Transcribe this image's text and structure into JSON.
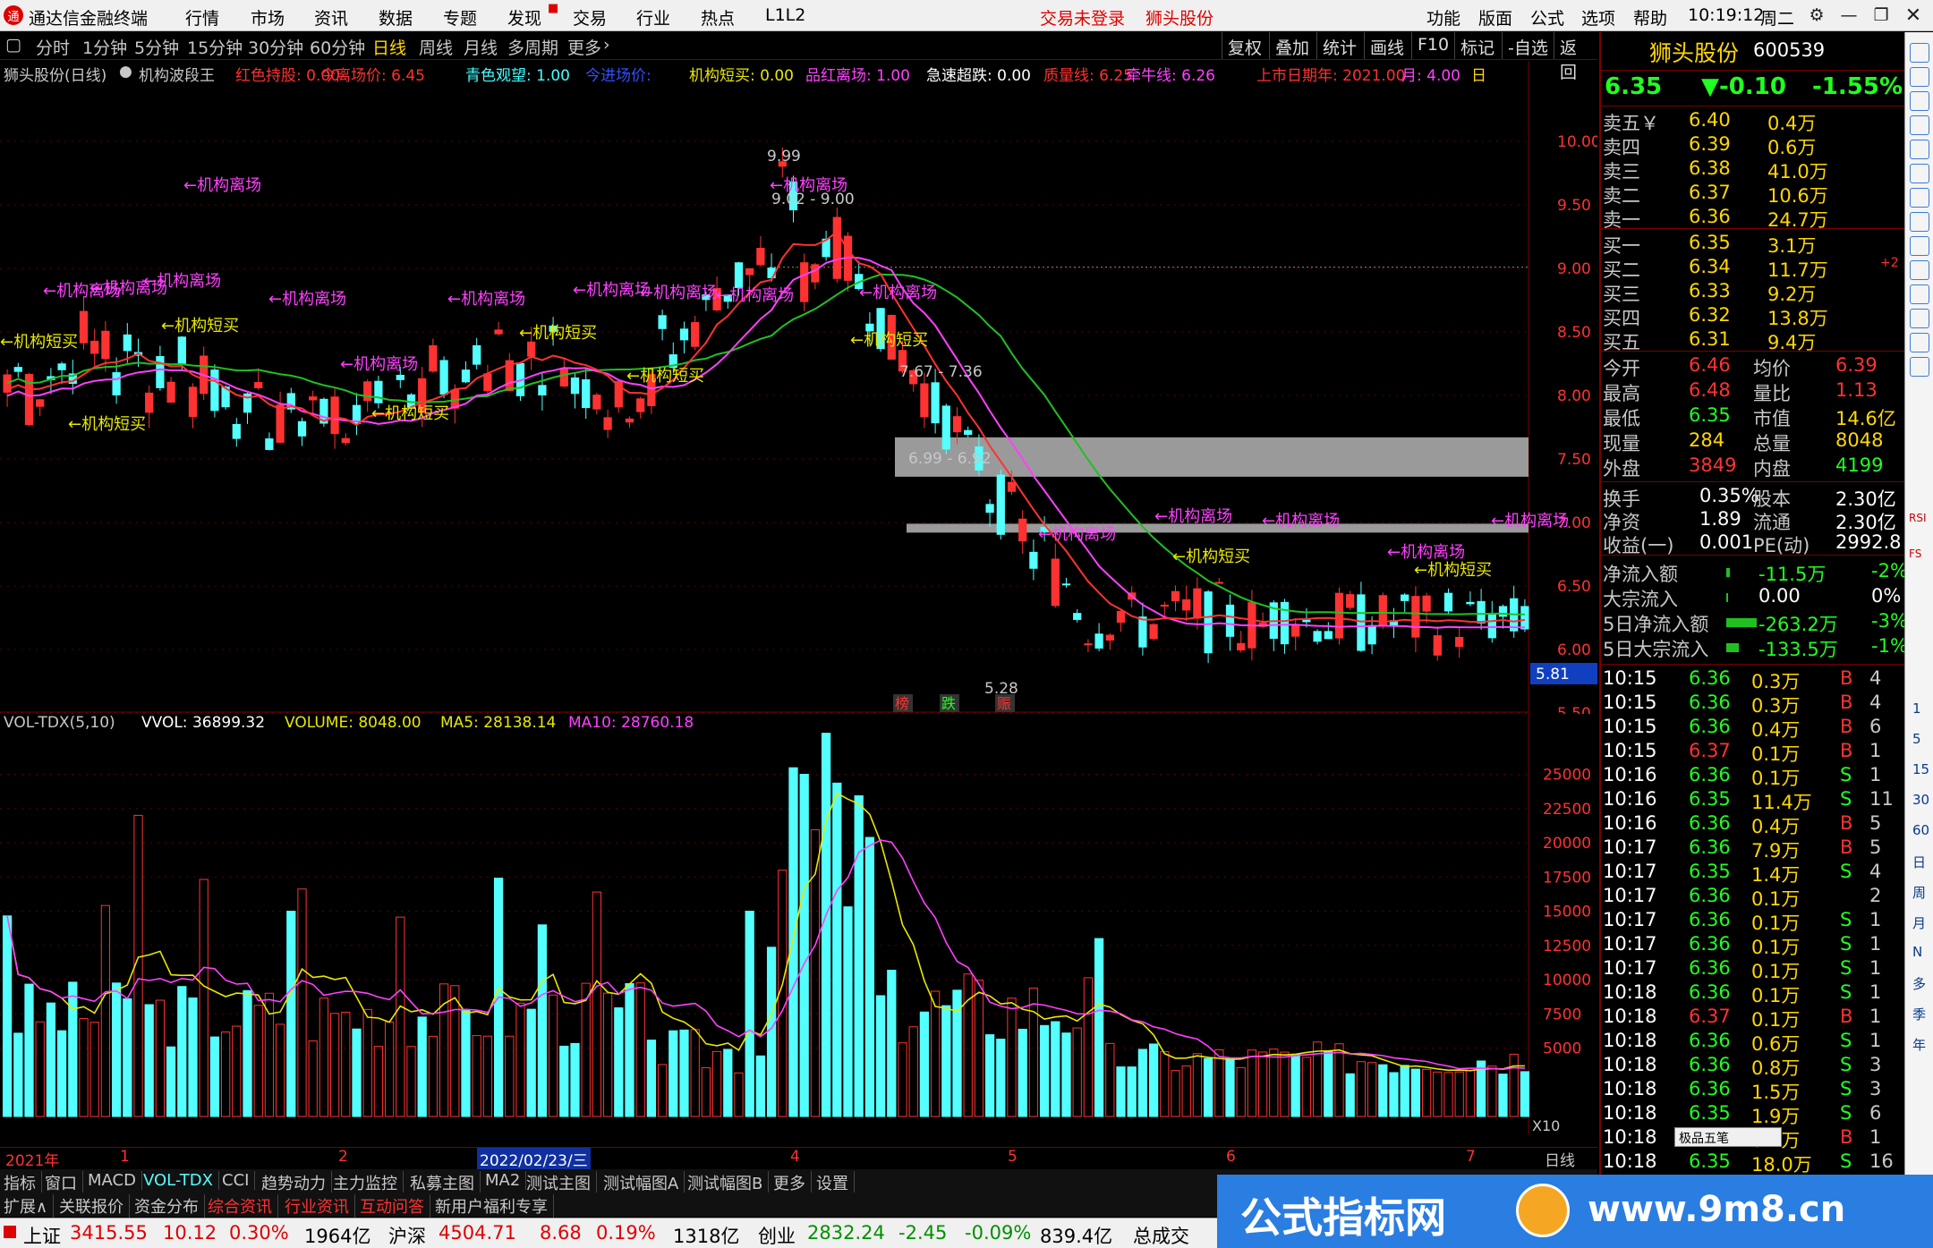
{
  "menubar": {
    "app_title": "通达信金融终端",
    "menus": [
      "行情",
      "市场",
      "资讯",
      "数据",
      "专题",
      "发现",
      "交易",
      "行业",
      "热点"
    ],
    "level": "L1L2",
    "login_status": "交易未登录",
    "stock_name": "狮头股份",
    "right_menus": [
      "功能",
      "版面",
      "公式",
      "选项",
      "帮助"
    ],
    "time": "10:19:12",
    "weekday": "周二"
  },
  "toolbar": {
    "periods": [
      "分时",
      "1分钟",
      "5分钟",
      "15分钟",
      "30分钟",
      "60分钟",
      "日线",
      "周线",
      "月线",
      "多周期",
      "更多"
    ],
    "active": "日线",
    "actions": [
      "复权",
      "叠加",
      "统计",
      "画线",
      "F10",
      "标记",
      "-自选",
      "返回"
    ]
  },
  "indicator_bar": {
    "name": "狮头股份(日线)",
    "formula": "机构波段王",
    "items": [
      {
        "label": "红色持股: 0.00",
        "color": "#ff3030"
      },
      {
        "label": "今离场价: 6.45",
        "color": "#ff3030"
      },
      {
        "label": "青色观望: 1.00",
        "color": "#40ffff"
      },
      {
        "label": "今进场价: ",
        "color": "#3050ff"
      },
      {
        "label": "机构短买: 0.00",
        "color": "#e8e800"
      },
      {
        "label": "品红离场: 1.00",
        "color": "#ff40ff"
      },
      {
        "label": "急速超跌: 0.00",
        "color": "#ffffff"
      },
      {
        "label": "质量线: 6.25",
        "color": "#ff3030"
      },
      {
        "label": "牵牛线: 6.26",
        "color": "#ff40ff"
      },
      {
        "label": "上市日期年: 2021.00",
        "color": "#ff3030"
      },
      {
        "label": "月: 4.00",
        "color": "#ff40ff"
      },
      {
        "label": "日",
        "color": "#ffd800"
      }
    ]
  },
  "price_axis": [
    "10.00",
    "9.50",
    "9.00",
    "8.50",
    "8.00",
    "7.50",
    "7.00",
    "6.50",
    "6.00",
    "5.50"
  ],
  "price_marker": "5.81",
  "annotations": {
    "high": "9.99",
    "low": "5.28",
    "range1": "9.02 - 9.00",
    "range2": "7.67 - 7.36",
    "range3": "6.99 - 6.92",
    "exit_label": "←机构离场",
    "buy_label": "←机构短买",
    "tags": [
      "榜",
      "跌",
      "赈"
    ]
  },
  "volume_bar": {
    "name": "VOL-TDX(5,10)",
    "vvol": "VVOL: 36899.32",
    "volume": "VOLUME: 8048.00",
    "ma5": "MA5: 28138.14",
    "ma10": "MA10: 28760.18"
  },
  "volume_axis": [
    "25000",
    "22500",
    "20000",
    "17500",
    "15000",
    "12500",
    "10000",
    "7500",
    "5000"
  ],
  "volume_scale": "X10",
  "date_axis": [
    "2021年",
    "1",
    "2",
    "2022/02/23/三",
    "4",
    "5",
    "6",
    "7"
  ],
  "period_label": "日线",
  "quote": {
    "name": "狮头股份",
    "code": "600539",
    "price": "6.35",
    "change": "▼-0.10",
    "pct": "-1.55%",
    "asks": [
      {
        "label": "卖五￥",
        "price": "6.40",
        "vol": "0.4万"
      },
      {
        "label": "卖四",
        "price": "6.39",
        "vol": "0.6万"
      },
      {
        "label": "卖三",
        "price": "6.38",
        "vol": "41.0万"
      },
      {
        "label": "卖二",
        "price": "6.37",
        "vol": "10.6万"
      },
      {
        "label": "卖一",
        "price": "6.36",
        "vol": "24.7万"
      }
    ],
    "bids": [
      {
        "label": "买一",
        "price": "6.35",
        "vol": "3.1万",
        "extra": ""
      },
      {
        "label": "买二",
        "price": "6.34",
        "vol": "11.7万",
        "extra": "+2"
      },
      {
        "label": "买三",
        "price": "6.33",
        "vol": "9.2万",
        "extra": ""
      },
      {
        "label": "买四",
        "price": "6.32",
        "vol": "13.8万",
        "extra": ""
      },
      {
        "label": "买五",
        "price": "6.31",
        "vol": "9.4万",
        "extra": ""
      }
    ],
    "stats": [
      [
        "今开",
        "6.46",
        "均价",
        "6.39"
      ],
      [
        "最高",
        "6.48",
        "量比",
        "1.13"
      ],
      [
        "最低",
        "6.35",
        "市值",
        "14.6亿"
      ],
      [
        "现量",
        "284",
        "总量",
        "8048"
      ],
      [
        "外盘",
        "3849",
        "内盘",
        "4199"
      ]
    ],
    "stats2": [
      [
        "换手",
        "0.35%",
        "股本",
        "2.30亿"
      ],
      [
        "净资",
        "1.89",
        "流通",
        "2.30亿"
      ],
      [
        "收益(一)",
        "0.001",
        "PE(动)",
        "2992.8"
      ]
    ],
    "flows": [
      [
        "净流入额",
        "-11.5万",
        "-2%"
      ],
      [
        "大宗流入",
        "0.00",
        "0%"
      ],
      [
        "5日净流入额",
        "-263.2万",
        "-3%"
      ],
      [
        "5日大宗流入",
        "-133.5万",
        "-1%"
      ]
    ],
    "ticks": [
      [
        "10:15",
        "6.36",
        "0.3万",
        "B",
        "4"
      ],
      [
        "10:15",
        "6.36",
        "0.3万",
        "B",
        "4"
      ],
      [
        "10:15",
        "6.36",
        "0.4万",
        "B",
        "6"
      ],
      [
        "10:15",
        "6.37",
        "0.1万",
        "B",
        "1"
      ],
      [
        "10:16",
        "6.36",
        "0.1万",
        "S",
        "1"
      ],
      [
        "10:16",
        "6.35",
        "11.4万",
        "S",
        "11"
      ],
      [
        "10:16",
        "6.36",
        "0.4万",
        "B",
        "5"
      ],
      [
        "10:17",
        "6.36",
        "7.9万",
        "B",
        "5"
      ],
      [
        "10:17",
        "6.35",
        "1.4万",
        "S",
        "4"
      ],
      [
        "10:17",
        "6.36",
        "0.1万",
        "",
        "2"
      ],
      [
        "10:17",
        "6.36",
        "0.1万",
        "S",
        "1"
      ],
      [
        "10:17",
        "6.36",
        "0.1万",
        "S",
        "1"
      ],
      [
        "10:17",
        "6.36",
        "0.1万",
        "S",
        "1"
      ],
      [
        "10:18",
        "6.36",
        "0.1万",
        "S",
        "1"
      ],
      [
        "10:18",
        "6.37",
        "0.1万",
        "B",
        "1"
      ],
      [
        "10:18",
        "6.36",
        "0.6万",
        "S",
        "1"
      ],
      [
        "10:18",
        "6.36",
        "0.8万",
        "S",
        "3"
      ],
      [
        "10:18",
        "6.36",
        "1.5万",
        "S",
        "3"
      ],
      [
        "10:18",
        "6.35",
        "1.9万",
        "S",
        "6"
      ],
      [
        "10:18",
        "6.35",
        "0.1万",
        "B",
        "1"
      ],
      [
        "10:18",
        "6.35",
        "18.0万",
        "S",
        "16"
      ]
    ],
    "tick_popup": "极品五笔"
  },
  "side_icons": [
    "RSI",
    "FS"
  ],
  "side_texts": [
    "1",
    "5",
    "15",
    "30",
    "60",
    "日",
    "周",
    "月",
    "N",
    "多",
    "季",
    "年"
  ],
  "tabs1": [
    "指标",
    "窗口",
    "MACD",
    "VOL-TDX",
    "CCI",
    "趋势动力",
    "主力监控",
    "私募主图",
    "MA2",
    "测试主图",
    "测试幅图A",
    "测试幅图B",
    "更多",
    "设置"
  ],
  "tabs1_active": "VOL-TDX",
  "tabs2": [
    "扩展∧",
    "关联报价",
    "资金分布",
    "综合资讯",
    "行业资讯",
    "互动问答",
    "新用户福利专享"
  ],
  "status": {
    "sh_label": "上证",
    "sh": "3415.55",
    "sh_chg": "10.12",
    "sh_pct": "0.30%",
    "sh_amt": "1964亿",
    "hs_label": "沪深",
    "hs": "4504.71",
    "hs_chg": "8.68",
    "hs_pct": "0.19%",
    "hs_amt": "1318亿",
    "cy_label": "创业",
    "cy": "2832.24",
    "cy_chg": "-2.45",
    "cy_pct": "-0.09%",
    "cy_amt": "839.4亿",
    "more": "总成交"
  },
  "banner": {
    "title": "公式指标网",
    "url": "www.9m8.cn"
  },
  "colors": {
    "up": "#ff3232",
    "down": "#54ffff",
    "ma5": "#ffffff",
    "ma10": "#e8e800",
    "ma20": "#ff40ff",
    "ma60": "#20c020",
    "grid": "#7a0000"
  }
}
